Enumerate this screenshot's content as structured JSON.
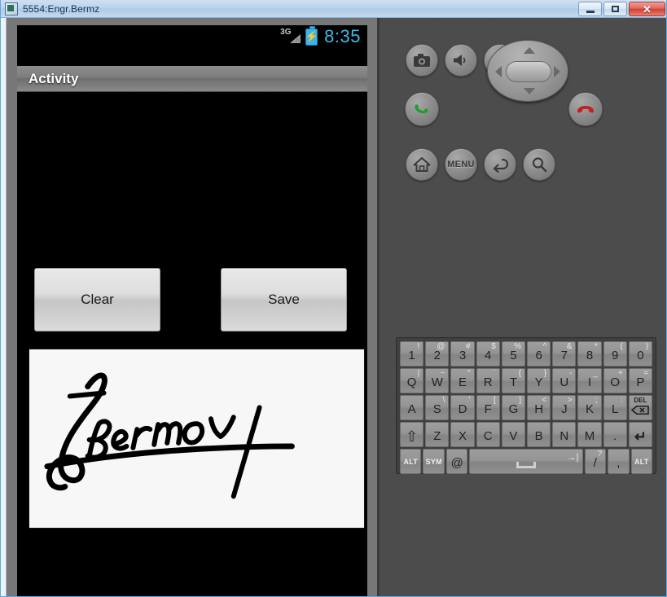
{
  "window": {
    "title": "5554:Engr.Bermz",
    "icon": "emulator-icon",
    "controls": [
      {
        "name": "minimize",
        "label": "–"
      },
      {
        "name": "restore",
        "label": "□"
      },
      {
        "name": "close",
        "label": "✕"
      }
    ]
  },
  "phone": {
    "status_bar": {
      "network": "3G",
      "network_state": "no-service",
      "battery_state": "charging",
      "time": "8:35",
      "time_color": "#3fb8e8"
    },
    "activity": {
      "title": "Activity"
    },
    "buttons": [
      {
        "name": "clear-button",
        "label": "Clear"
      },
      {
        "name": "save-button",
        "label": "Save"
      }
    ],
    "signature_canvas": {
      "name": "signature-canvas",
      "content": "Bermoy",
      "ink_color": "#000000",
      "background": "#f7f7f7"
    }
  },
  "controls_panel": {
    "hardware_buttons": [
      {
        "name": "camera-button",
        "icon": "camera-icon"
      },
      {
        "name": "volume-down-button",
        "icon": "volume-down-icon"
      },
      {
        "name": "volume-up-button",
        "icon": "volume-up-icon"
      },
      {
        "name": "power-button",
        "icon": "power-icon"
      },
      {
        "name": "call-button",
        "icon": "phone-green-icon"
      },
      {
        "name": "end-call-button",
        "icon": "phone-red-icon"
      },
      {
        "name": "home-button",
        "icon": "home-icon"
      },
      {
        "name": "menu-button",
        "icon": "menu-text-icon",
        "label": "MENU"
      },
      {
        "name": "back-button",
        "icon": "back-arrow-icon"
      },
      {
        "name": "search-button",
        "icon": "search-icon"
      }
    ],
    "dpad": {
      "name": "dpad",
      "directions": [
        "up",
        "down",
        "left",
        "right"
      ],
      "center": "ok"
    }
  },
  "keyboard": {
    "rows": [
      [
        {
          "main": "1",
          "sup": "!"
        },
        {
          "main": "2",
          "sup": "@"
        },
        {
          "main": "3",
          "sup": "#"
        },
        {
          "main": "4",
          "sup": "$"
        },
        {
          "main": "5",
          "sup": "%"
        },
        {
          "main": "6",
          "sup": "^"
        },
        {
          "main": "7",
          "sup": "&"
        },
        {
          "main": "8",
          "sup": "*"
        },
        {
          "main": "9",
          "sup": "("
        },
        {
          "main": "0",
          "sup": ")"
        }
      ],
      [
        {
          "main": "Q",
          "sup": "|"
        },
        {
          "main": "W",
          "sup": "~"
        },
        {
          "main": "E",
          "sup": "“"
        },
        {
          "main": "R",
          "sup": "`"
        },
        {
          "main": "T",
          "sup": "{"
        },
        {
          "main": "Y",
          "sup": "}"
        },
        {
          "main": "U",
          "sup": "-"
        },
        {
          "main": "I",
          "sup": "_"
        },
        {
          "main": "O",
          "sup": "+"
        },
        {
          "main": "P",
          "sup": "="
        }
      ],
      [
        {
          "main": "A",
          "sup": ""
        },
        {
          "main": "S",
          "sup": "\\"
        },
        {
          "main": "D",
          "sup": "’"
        },
        {
          "main": "F",
          "sup": "["
        },
        {
          "main": "G",
          "sup": "]"
        },
        {
          "main": "H",
          "sup": "<"
        },
        {
          "main": "J",
          "sup": ">"
        },
        {
          "main": "K",
          "sup": ";"
        },
        {
          "main": "L",
          "sup": ":"
        },
        {
          "main": "DEL",
          "sup": "",
          "type": "del"
        }
      ],
      [
        {
          "main": "⇧",
          "sup": "",
          "type": "shift"
        },
        {
          "main": "Z",
          "sup": ""
        },
        {
          "main": "X",
          "sup": ""
        },
        {
          "main": "C",
          "sup": ""
        },
        {
          "main": "V",
          "sup": ""
        },
        {
          "main": "B",
          "sup": ""
        },
        {
          "main": "N",
          "sup": ""
        },
        {
          "main": "M",
          "sup": ""
        },
        {
          "main": ".",
          "sup": ""
        },
        {
          "main": "↵",
          "sup": "",
          "type": "enter"
        }
      ],
      [
        {
          "main": "ALT",
          "sup": "",
          "type": "label"
        },
        {
          "main": "SYM",
          "sup": "",
          "type": "label"
        },
        {
          "main": "@",
          "sup": ""
        },
        {
          "main": "",
          "sup": "",
          "type": "space"
        },
        {
          "main": "/",
          "sup": "?"
        },
        {
          "main": ",",
          "sup": ""
        },
        {
          "main": "ALT",
          "sup": "",
          "type": "label"
        }
      ]
    ]
  }
}
